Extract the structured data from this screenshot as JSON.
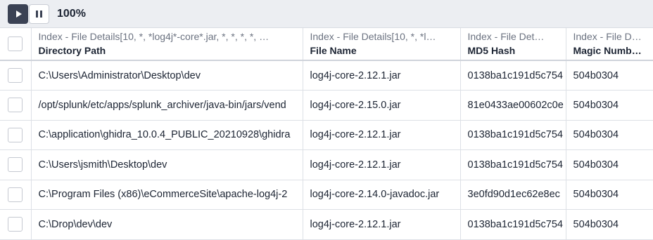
{
  "toolbar": {
    "zoom": "100%"
  },
  "columns": [
    {
      "group": "Index - File Details[10, *, *log4j*-core*.jar, *, *, *, *, …",
      "title": "Directory Path"
    },
    {
      "group": "Index - File Details[10, *, *l…",
      "title": "File Name"
    },
    {
      "group": "Index - File Det…",
      "title": "MD5 Hash"
    },
    {
      "group": "Index - File Det…",
      "title": "Magic Number …"
    }
  ],
  "rows": [
    {
      "path": "C:\\Users\\Administrator\\Desktop\\dev",
      "file": "log4j-core-2.12.1.jar",
      "md5": "0138ba1c191d5c754",
      "magic": "504b0304"
    },
    {
      "path": "/opt/splunk/etc/apps/splunk_archiver/java-bin/jars/vend",
      "file": "log4j-core-2.15.0.jar",
      "md5": "81e0433ae00602c0e",
      "magic": "504b0304"
    },
    {
      "path": "C:\\application\\ghidra_10.0.4_PUBLIC_20210928\\ghidra",
      "file": "log4j-core-2.12.1.jar",
      "md5": "0138ba1c191d5c754",
      "magic": "504b0304"
    },
    {
      "path": "C:\\Users\\jsmith\\Desktop\\dev",
      "file": "log4j-core-2.12.1.jar",
      "md5": "0138ba1c191d5c754",
      "magic": "504b0304"
    },
    {
      "path": "C:\\Program Files (x86)\\eCommerceSite\\apache-log4j-2",
      "file": "log4j-core-2.14.0-javadoc.jar",
      "md5": "3e0fd90d1ec62e8ec",
      "magic": "504b0304"
    },
    {
      "path": "C:\\Drop\\dev\\dev",
      "file": "log4j-core-2.12.1.jar",
      "md5": "0138ba1c191d5c754",
      "magic": "504b0304"
    }
  ]
}
